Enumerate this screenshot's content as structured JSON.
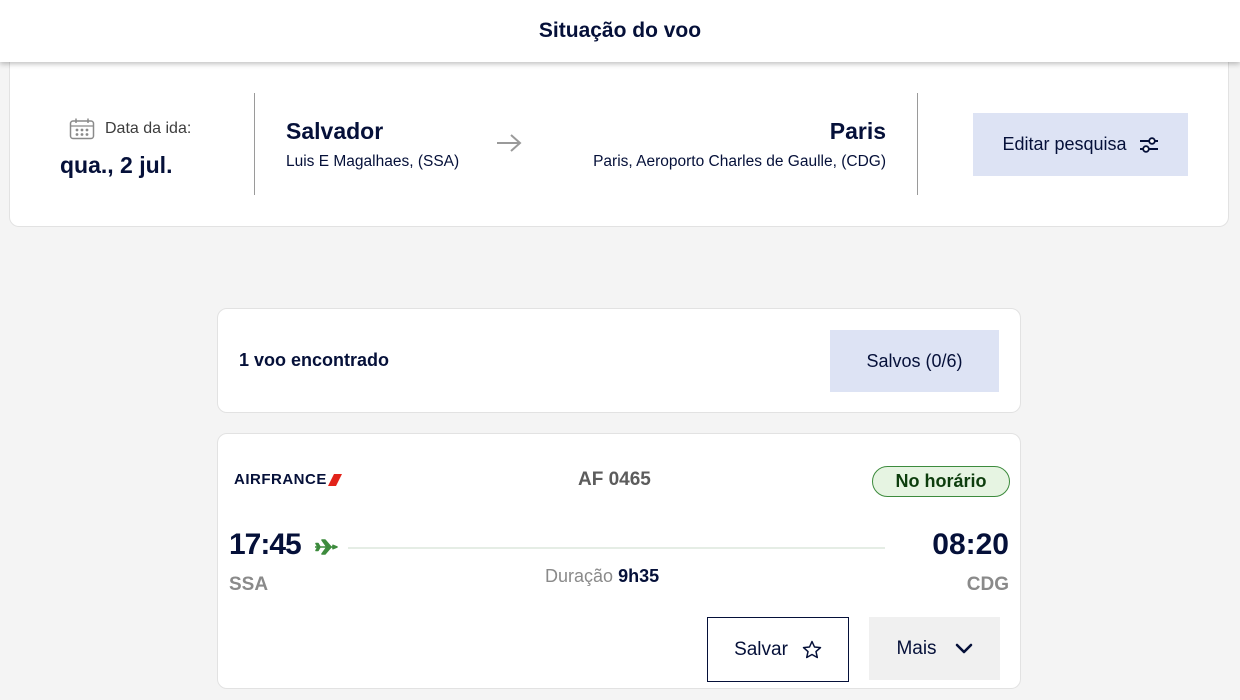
{
  "header": {
    "title": "Situação do voo"
  },
  "search": {
    "date_label": "Data da ida:",
    "date_value": "qua., 2 jul.",
    "origin": {
      "city": "Salvador",
      "airport": "Luis E Magalhaes, (SSA)"
    },
    "destination": {
      "city": "Paris",
      "airport": "Paris, Aeroporto Charles de Gaulle, (CDG)"
    },
    "edit_label": "Editar pesquisa",
    "icons": {
      "calendar": "calendar-icon",
      "arrow": "arrow-right-icon",
      "filter": "sliders-icon"
    }
  },
  "results": {
    "count_label": "1 voo encontrado",
    "saved_label": "Salvos (0/6)"
  },
  "flight": {
    "airline": "AIRFRANCE",
    "flight_number": "AF 0465",
    "status": "No horário",
    "departure_time": "17:45",
    "arrival_time": "08:20",
    "departure_code": "SSA",
    "arrival_code": "CDG",
    "duration_label": "Duração",
    "duration_value": "9h35",
    "save_label": "Salvar",
    "more_label": "Mais"
  },
  "colors": {
    "navy": "#051039",
    "accent_bg": "#dde3f4",
    "status_green": "#3d8b3d",
    "airline_red": "#e2231a"
  }
}
